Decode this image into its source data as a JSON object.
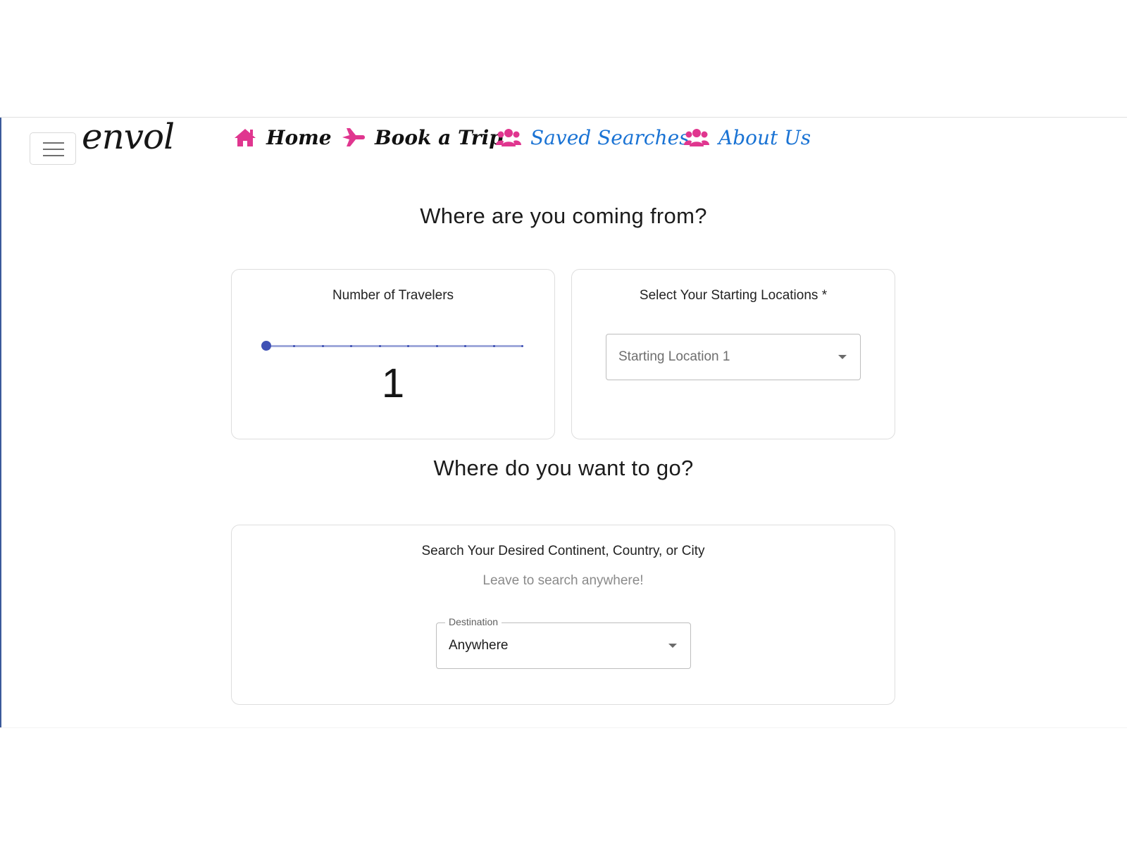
{
  "header": {
    "menu_icon": "hamburger-menu-icon",
    "logo": "envol",
    "nav": [
      {
        "label": "Home",
        "icon": "home-icon"
      },
      {
        "label": "Book a Trip",
        "icon": "airplane-icon"
      },
      {
        "label": "Saved Searches",
        "icon": "users-icon"
      },
      {
        "label": "About Us",
        "icon": "users-icon"
      }
    ],
    "colors": {
      "accent_pink": "#e0368f",
      "link_blue": "#1a73d4",
      "slider_blue": "#3f51b5"
    }
  },
  "origin": {
    "heading": "Where are you coming from?",
    "travelers": {
      "title": "Number of Travelers",
      "value": "1",
      "slider_fraction": 0.0,
      "steps": 10
    },
    "starting": {
      "title": "Select Your Starting Locations *",
      "placeholder": "Starting Location 1"
    }
  },
  "destination": {
    "heading": "Where do you want to go?",
    "title": "Search Your Desired Continent, Country, or City",
    "subtitle": "Leave to search anywhere!",
    "field_label": "Destination",
    "value": "Anywhere"
  }
}
